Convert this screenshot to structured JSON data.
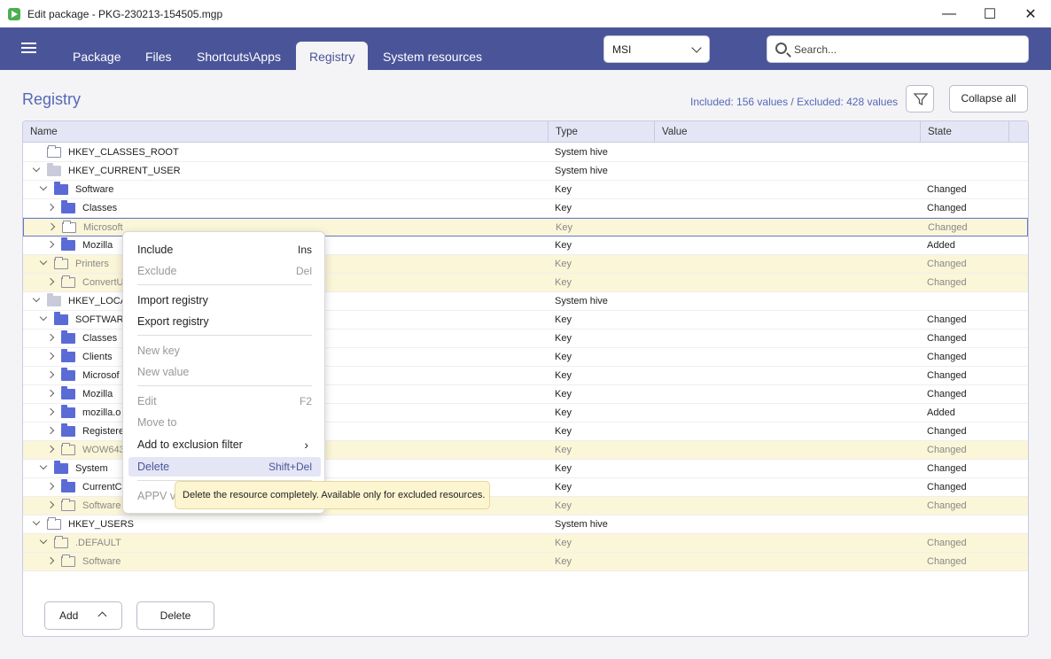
{
  "window": {
    "title": "Edit package - PKG-230213-154505.mgp",
    "minimize": "—",
    "maximize": "☐",
    "close": "✕"
  },
  "nav": {
    "tabs": [
      "Package",
      "Files",
      "Shortcuts\\Apps",
      "Registry",
      "System resources"
    ],
    "active_tab": "Registry",
    "format_select": "MSI",
    "search_placeholder": "Search..."
  },
  "page": {
    "title": "Registry",
    "counts": "Included: 156 values / Excluded: 428 values",
    "collapse_all": "Collapse all"
  },
  "grid": {
    "columns": [
      "Name",
      "Type",
      "Value",
      "State"
    ],
    "rows": [
      {
        "name": "HKEY_CLASSES_ROOT",
        "type": "System hive",
        "state": ""
      },
      {
        "name": "HKEY_CURRENT_USER",
        "type": "System hive",
        "state": ""
      },
      {
        "name": "Software",
        "type": "Key",
        "state": "Changed"
      },
      {
        "name": "Classes",
        "type": "Key",
        "state": "Changed"
      },
      {
        "name": "Microsoft",
        "type": "Key",
        "state": "Changed"
      },
      {
        "name": "Mozilla",
        "type": "Key",
        "state": "Added"
      },
      {
        "name": "Printers",
        "type": "Key",
        "state": "Changed"
      },
      {
        "name": "ConvertU",
        "type": "Key",
        "state": "Changed"
      },
      {
        "name": "HKEY_LOCAL",
        "type": "System hive",
        "state": ""
      },
      {
        "name": "SOFTWARE",
        "type": "Key",
        "state": "Changed"
      },
      {
        "name": "Classes",
        "type": "Key",
        "state": "Changed"
      },
      {
        "name": "Clients",
        "type": "Key",
        "state": "Changed"
      },
      {
        "name": "Microsof",
        "type": "Key",
        "state": "Changed"
      },
      {
        "name": "Mozilla",
        "type": "Key",
        "state": "Changed"
      },
      {
        "name": "mozilla.o",
        "type": "Key",
        "state": "Added"
      },
      {
        "name": "Registere",
        "type": "Key",
        "state": "Changed"
      },
      {
        "name": "WOW643",
        "type": "Key",
        "state": "Changed"
      },
      {
        "name": "System",
        "type": "Key",
        "state": "Changed"
      },
      {
        "name": "CurrentC",
        "type": "Key",
        "state": "Changed"
      },
      {
        "name": "Software",
        "type": "Key",
        "state": "Changed"
      },
      {
        "name": "HKEY_USERS",
        "type": "System hive",
        "state": ""
      },
      {
        "name": ".DEFAULT",
        "type": "Key",
        "state": "Changed"
      },
      {
        "name": "Software",
        "type": "Key",
        "state": "Changed"
      }
    ]
  },
  "bottom": {
    "add": "Add",
    "delete": "Delete"
  },
  "context_menu": {
    "include": "Include",
    "include_sc": "Ins",
    "exclude": "Exclude",
    "exclude_sc": "Del",
    "import": "Import registry",
    "export": "Export registry",
    "new_key": "New key",
    "new_value": "New value",
    "edit": "Edit",
    "edit_sc": "F2",
    "move_to": "Move to",
    "add_filter": "Add to exclusion filter",
    "delete": "Delete",
    "delete_sc": "Shift+Del",
    "appv": "APPV vi"
  },
  "tooltip": "Delete the resource completely. Available only for excluded resources."
}
